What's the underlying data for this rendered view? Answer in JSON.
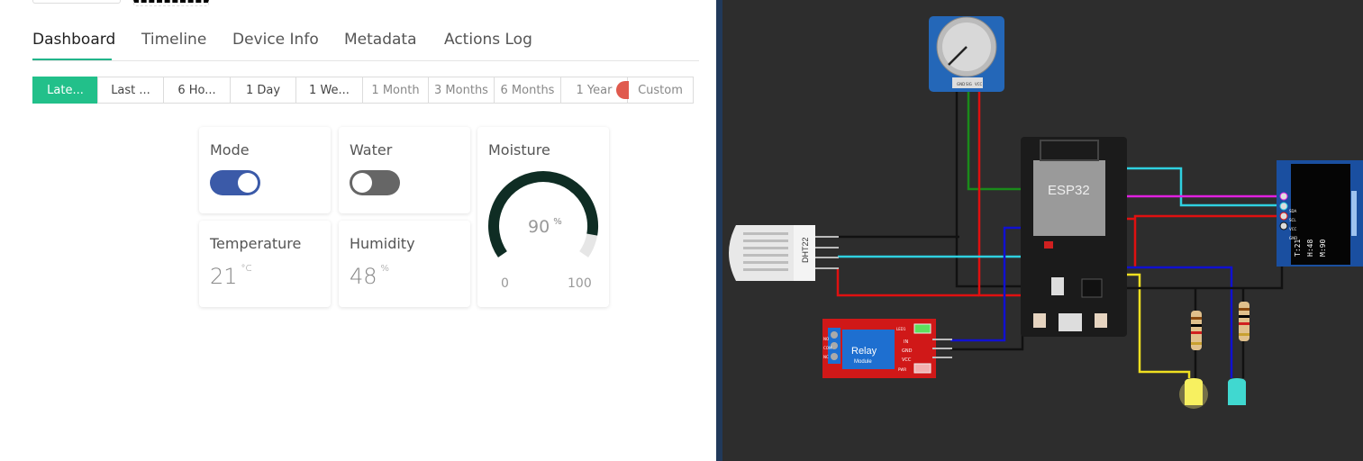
{
  "tabs": [
    {
      "label": "Dashboard"
    },
    {
      "label": "Timeline"
    },
    {
      "label": "Device Info"
    },
    {
      "label": "Metadata"
    },
    {
      "label": "Actions Log"
    }
  ],
  "ranges": [
    {
      "label": "Late..."
    },
    {
      "label": "Last ..."
    },
    {
      "label": "6 Ho..."
    },
    {
      "label": "1 Day"
    },
    {
      "label": "1 We..."
    },
    {
      "label": "1 Month"
    },
    {
      "label": "3 Months"
    },
    {
      "label": "6 Months"
    },
    {
      "label": "1 Year"
    },
    {
      "label": "Custom"
    }
  ],
  "widgets": {
    "mode": {
      "title": "Mode",
      "on": true,
      "color": "#3b5aa8"
    },
    "water": {
      "title": "Water",
      "on": false,
      "color": "#666666"
    },
    "moisture": {
      "title": "Moisture",
      "value": "90",
      "unit": "%",
      "min": "0",
      "max": "100",
      "fraction": 0.9
    },
    "temperature": {
      "title": "Temperature",
      "value": "21",
      "unit": "°C"
    },
    "humidity": {
      "title": "Humidity",
      "value": "48",
      "unit": "%"
    }
  },
  "colors": {
    "accent": "#22c08a",
    "gauge_fill": "#0f2d24",
    "divider": "#21395a",
    "simulator_bg": "#2d2d2d"
  },
  "simulator": {
    "esp32_label": "ESP32",
    "dht_label": "DHT22",
    "relay_label": "Relay",
    "relay_sublabel": "Module",
    "relay_pins": [
      "IN",
      "GND",
      "VCC"
    ],
    "relay_leds": [
      "LED1",
      "PWR"
    ],
    "relay_terminals": [
      "NO",
      "COM",
      "NC"
    ],
    "pot_pins": [
      "GND",
      "SIG",
      "VCC"
    ],
    "oled_pins": [
      "GND",
      "VCC",
      "SCL",
      "SDA"
    ],
    "oled_lines": [
      "T:21",
      "H:48",
      "M:90"
    ]
  }
}
